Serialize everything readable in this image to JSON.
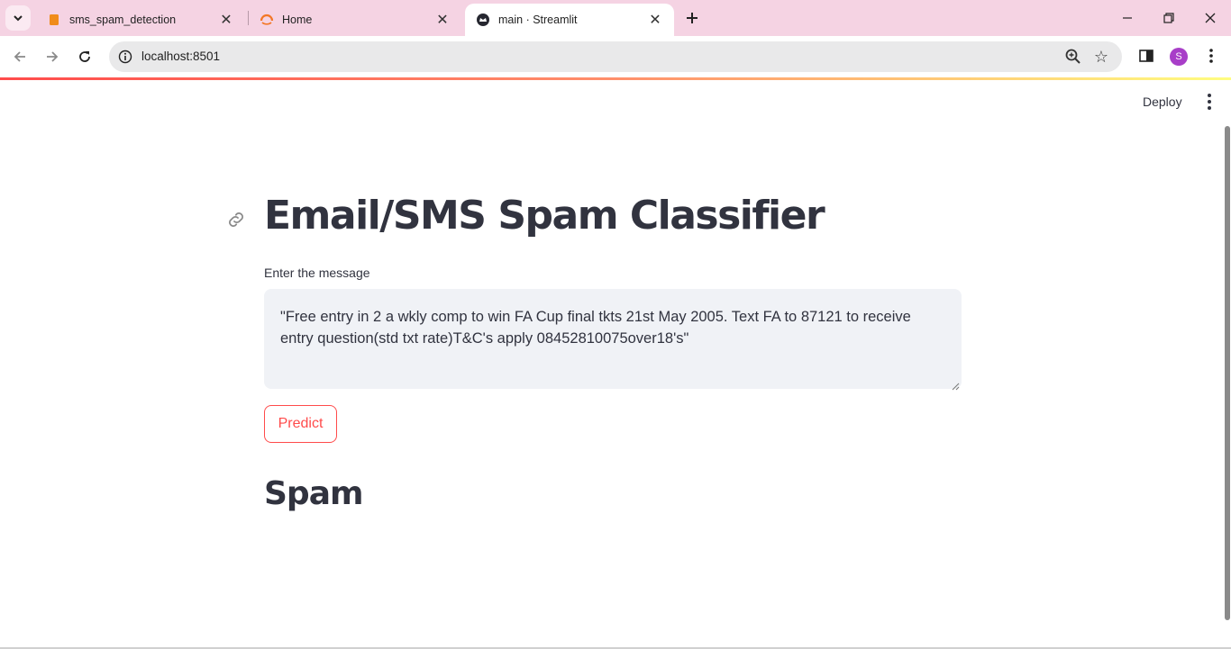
{
  "browser": {
    "tabs": [
      {
        "title": "sms_spam_detection",
        "favicon": "notebook-icon",
        "active": false
      },
      {
        "title": "Home",
        "favicon": "jupyter-icon",
        "active": false
      },
      {
        "title": "main · Streamlit",
        "favicon": "streamlit-icon",
        "active": true
      }
    ],
    "url": "localhost:8501",
    "profile_initial": "S",
    "colors": {
      "tab_strip": "#f5d3e3",
      "profile": "#a83ec8"
    }
  },
  "app": {
    "deploy_label": "Deploy",
    "title": "Email/SMS Spam Classifier",
    "input_label": "Enter the message",
    "message": "\"Free entry in 2 a wkly comp to win FA Cup final tkts 21st May 2005. Text FA to 87121 to receive entry question(std txt rate)T&C's apply 08452810075over18's\"",
    "predict_label": "Predict",
    "result": "Spam",
    "colors": {
      "primary": "#ff4b4b",
      "text": "#31333f",
      "input_bg": "#f0f2f6"
    }
  }
}
